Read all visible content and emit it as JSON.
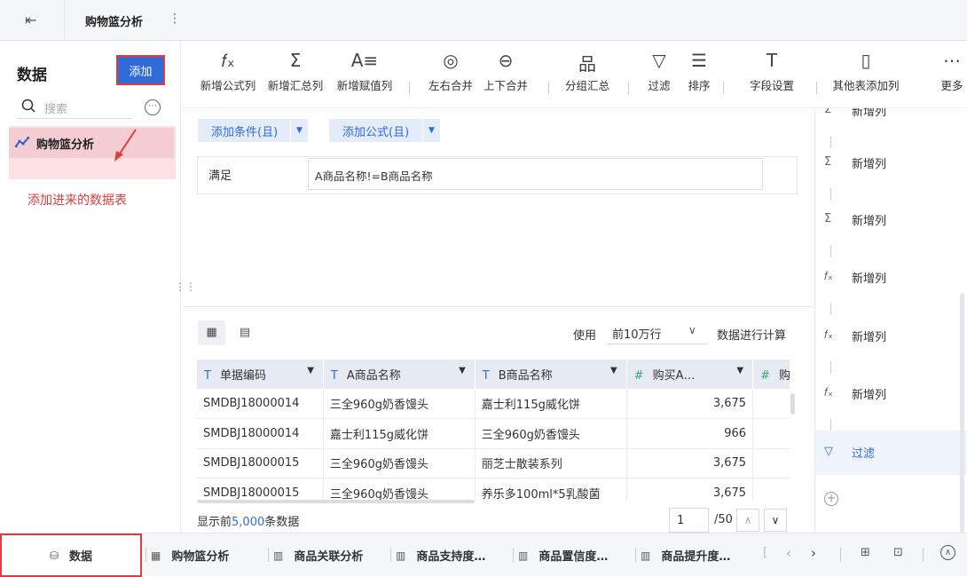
{
  "header": {
    "back_icon": "exit-icon",
    "title": "购物篮分析",
    "more_icon": "more-vertical-icon"
  },
  "left": {
    "title": "数据",
    "add_label": "添加",
    "search_placeholder": "搜索",
    "dataset_name": "购物篮分析",
    "note": "添加进来的数据表"
  },
  "toolbar": [
    {
      "icon": "fx-icon",
      "glyph": "𝑓ₓ",
      "label": "新增公式列"
    },
    {
      "icon": "sum-icon",
      "glyph": "Σ",
      "label": "新增汇总列"
    },
    {
      "icon": "assign-icon",
      "glyph": "A≡",
      "label": "新增赋值列"
    },
    {
      "icon": "lr-merge-icon",
      "glyph": "◎",
      "label": "左右合并"
    },
    {
      "icon": "ud-merge-icon",
      "glyph": "⊖",
      "label": "上下合并"
    },
    {
      "icon": "group-icon",
      "glyph": "品",
      "label": "分组汇总"
    },
    {
      "icon": "filter-icon",
      "glyph": "▽",
      "label": "过滤"
    },
    {
      "icon": "sort-icon",
      "glyph": "☰",
      "label": "排序"
    },
    {
      "icon": "field-settings-icon",
      "glyph": "T",
      "label": "字段设置"
    },
    {
      "icon": "add-column-icon",
      "glyph": "▯",
      "label": "其他表添加列"
    },
    {
      "icon": "more-icon",
      "glyph": "⋯",
      "label": "更多"
    }
  ],
  "condition": {
    "add_condition": "添加条件(且)",
    "add_formula": "添加公式(且)",
    "satisfy_label": "满足",
    "formula": "A商品名称!=B商品名称"
  },
  "preview": {
    "use_label": "使用",
    "rows_option": "前10万行",
    "calc_label": "数据进行计算",
    "columns": [
      {
        "type": "T",
        "name": "单据编码"
      },
      {
        "type": "T",
        "name": "A商品名称"
      },
      {
        "type": "T",
        "name": "B商品名称"
      },
      {
        "type": "#",
        "name": "购买A…"
      },
      {
        "type": "#",
        "name": "购买B"
      }
    ],
    "rows": [
      [
        "SMDBJ18000014",
        "三全960g奶香馒头",
        "嘉士利115g威化饼",
        "3,675",
        ""
      ],
      [
        "SMDBJ18000014",
        "嘉士利115g威化饼",
        "三全960g奶香馒头",
        "966",
        ""
      ],
      [
        "SMDBJ18000015",
        "三全960g奶香馒头",
        "丽芝士散装系列",
        "3,675",
        ""
      ],
      [
        "SMDBJ18000015",
        "三全960g奶香馒头",
        "养乐多100ml*5乳酸菌",
        "3,675",
        ""
      ]
    ],
    "footer_prefix": "显示前",
    "footer_count": "5,000",
    "footer_suffix": "条数据",
    "page": "1",
    "page_total": "/50"
  },
  "steps": [
    {
      "icon": "sum-icon",
      "glyph": "Σ",
      "label": "新增列"
    },
    {
      "icon": "sum-icon",
      "glyph": "Σ",
      "label": "新增列"
    },
    {
      "icon": "sum-icon",
      "glyph": "Σ",
      "label": "新增列"
    },
    {
      "icon": "fx-icon",
      "glyph": "𝑓ₓ",
      "label": "新增列"
    },
    {
      "icon": "fx-icon",
      "glyph": "𝑓ₓ",
      "label": "新增列"
    },
    {
      "icon": "fx-icon",
      "glyph": "𝑓ₓ",
      "label": "新增列"
    },
    {
      "icon": "filter-icon",
      "glyph": "▽",
      "label": "过滤"
    }
  ],
  "bottom_tabs": [
    {
      "icon": "database-icon",
      "glyph": "⛁",
      "label": "数据"
    },
    {
      "icon": "dashboard-icon",
      "glyph": "▦",
      "label": "购物篮分析"
    },
    {
      "icon": "chart-icon",
      "glyph": "▥",
      "label": "商品关联分析"
    },
    {
      "icon": "chart-icon",
      "glyph": "▥",
      "label": "商品支持度…"
    },
    {
      "icon": "chart-icon",
      "glyph": "▥",
      "label": "商品置信度…"
    },
    {
      "icon": "chart-icon",
      "glyph": "▥",
      "label": "商品提升度…"
    }
  ],
  "colors": {
    "accent": "#2f6bd9",
    "highlight": "#e03c3c"
  }
}
